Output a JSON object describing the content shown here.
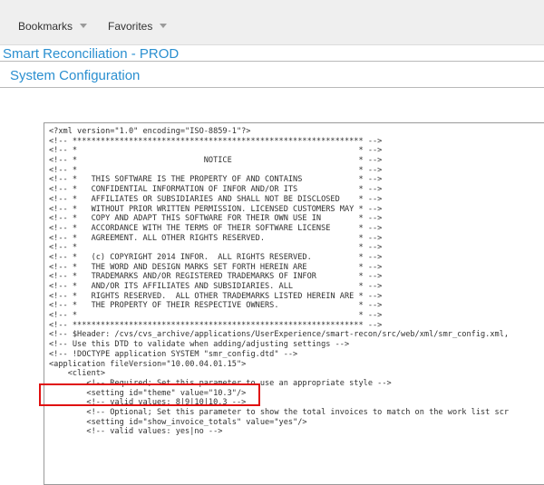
{
  "topbar": {
    "menu": [
      {
        "label": "Bookmarks"
      },
      {
        "label": "Favorites"
      }
    ]
  },
  "app_title": "Smart Reconciliation - PROD",
  "page_title": "System Configuration",
  "config_lines": [
    "<?xml version=\"1.0\" encoding=\"ISO-8859-1\"?>",
    "<!-- ************************************************************** -->",
    "<!-- *                                                            * -->",
    "<!-- *                           NOTICE                           * -->",
    "<!-- *                                                            * -->",
    "<!-- *   THIS SOFTWARE IS THE PROPERTY OF AND CONTAINS            * -->",
    "<!-- *   CONFIDENTIAL INFORMATION OF INFOR AND/OR ITS             * -->",
    "<!-- *   AFFILIATES OR SUBSIDIARIES AND SHALL NOT BE DISCLOSED    * -->",
    "<!-- *   WITHOUT PRIOR WRITTEN PERMISSION. LICENSED CUSTOMERS MAY * -->",
    "<!-- *   COPY AND ADAPT THIS SOFTWARE FOR THEIR OWN USE IN        * -->",
    "<!-- *   ACCORDANCE WITH THE TERMS OF THEIR SOFTWARE LICENSE      * -->",
    "<!-- *   AGREEMENT. ALL OTHER RIGHTS RESERVED.                    * -->",
    "<!-- *                                                            * -->",
    "<!-- *   (c) COPYRIGHT 2014 INFOR.  ALL RIGHTS RESERVED.          * -->",
    "<!-- *   THE WORD AND DESIGN MARKS SET FORTH HEREIN ARE           * -->",
    "<!-- *   TRADEMARKS AND/OR REGISTERED TRADEMARKS OF INFOR         * -->",
    "<!-- *   AND/OR ITS AFFILIATES AND SUBSIDIARIES. ALL              * -->",
    "<!-- *   RIGHTS RESERVED.  ALL OTHER TRADEMARKS LISTED HEREIN ARE * -->",
    "<!-- *   THE PROPERTY OF THEIR RESPECTIVE OWNERS.                 * -->",
    "<!-- *                                                            * -->",
    "<!-- ************************************************************** -->",
    "<!-- $Header: /cvs/cvs_archive/applications/UserExperience/smart-recon/src/web/xml/smr_config.xml,",
    "<!-- Use this DTD to validate when adding/adjusting settings -->",
    "<!-- !DOCTYPE application SYSTEM \"smr_config.dtd\" -->",
    "<application fileVersion=\"10.00.04.01.15\">",
    "    <client>",
    "        <!-- Required; Set this parameter to use an appropriate style -->",
    "        <setting id=\"theme\" value=\"10.3\"/>",
    "        <!-- valid values: 8|9|10|10.3 -->",
    "        <!-- Optional; Set this parameter to show the total invoices to match on the work list scr",
    "        <setting id=\"show_invoice_totals\" value=\"yes\"/>",
    "        <!-- valid values: yes|no -->"
  ]
}
